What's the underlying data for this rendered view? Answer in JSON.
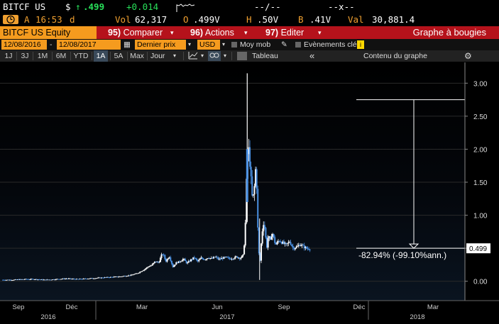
{
  "ticker": {
    "symbol": "BITCF US",
    "currency_symbol": "$",
    "arrow": "↑",
    "last_price": ".499",
    "change": "+0.014",
    "sparkline_label": "Γ",
    "range_text": "--/--",
    "range_text2": "--x--",
    "clock_icon": "clock-icon",
    "status_letter": "A",
    "time": "16:53",
    "time_suffix": "d",
    "vol_label": "Vol",
    "volume": "62,317",
    "open_label": "O",
    "open": ".499V",
    "high_label": "H",
    "high": ".50V",
    "bid_label": "B",
    "bid": ".41V",
    "val_label": "Val",
    "value": "30,881.4"
  },
  "menubar": {
    "equity": "BITCF US Equity",
    "items": [
      {
        "num": "95)",
        "label": "Comparer"
      },
      {
        "num": "96)",
        "label": "Actions"
      },
      {
        "num": "97)",
        "label": "Editer"
      }
    ],
    "chart_type": "Graphe à bougies"
  },
  "daterow": {
    "start_date": "12/08/2016",
    "dash": "-",
    "end_date": "12/08/2017",
    "price_field": "Dernier prix",
    "currency": "USD",
    "moy_mob": "Moy mob",
    "events": "Evènements clés",
    "info": "i"
  },
  "periodrow": {
    "periods": [
      "1J",
      "3J",
      "1M",
      "6M",
      "YTD",
      "1A",
      "5A",
      "Max"
    ],
    "active": "1A",
    "frequency": "Jour",
    "tableau": "Tableau",
    "collapse": "«",
    "content": "Contenu du graphe",
    "settings_icon": "gear-icon"
  },
  "chart_data": {
    "type": "candlestick",
    "ylim": [
      -0.1,
      3.1
    ],
    "yticks": [
      "3.00",
      "2.50",
      "2.00",
      "1.50",
      "1.00",
      "0.50",
      "0.00"
    ],
    "ytick_values": [
      3.0,
      2.5,
      2.0,
      1.5,
      1.0,
      0.5,
      0.0
    ],
    "last_price_label": "0.499",
    "last_price": 0.499,
    "month_labels": [
      "Sep",
      "Déc",
      "Mar",
      "Jun",
      "Sep",
      "Déc",
      "Mar"
    ],
    "year_labels": [
      "2016",
      "2017",
      "2018"
    ],
    "annotation": "-82.94% (-99.10%ann.)",
    "annotation_high": 2.75,
    "annotation_low": 0.5,
    "colors": {
      "up": "#ffffff",
      "down": "#4a90e2",
      "background": "#000000",
      "grid": "#2a2a2a"
    },
    "series": [
      {
        "x": 0.0,
        "y": 0.02
      },
      {
        "x": 0.03,
        "y": 0.02
      },
      {
        "x": 0.06,
        "y": 0.03
      },
      {
        "x": 0.09,
        "y": 0.03
      },
      {
        "x": 0.12,
        "y": 0.02
      },
      {
        "x": 0.15,
        "y": 0.03
      },
      {
        "x": 0.18,
        "y": 0.04
      },
      {
        "x": 0.21,
        "y": 0.03
      },
      {
        "x": 0.24,
        "y": 0.04
      },
      {
        "x": 0.27,
        "y": 0.05
      },
      {
        "x": 0.3,
        "y": 0.06
      },
      {
        "x": 0.33,
        "y": 0.07
      },
      {
        "x": 0.36,
        "y": 0.09
      },
      {
        "x": 0.38,
        "y": 0.12
      },
      {
        "x": 0.4,
        "y": 0.18
      },
      {
        "x": 0.41,
        "y": 0.22
      },
      {
        "x": 0.42,
        "y": 0.24
      },
      {
        "x": 0.43,
        "y": 0.3
      },
      {
        "x": 0.44,
        "y": 0.28
      },
      {
        "x": 0.45,
        "y": 0.42
      },
      {
        "x": 0.455,
        "y": 0.38
      },
      {
        "x": 0.46,
        "y": 0.3
      },
      {
        "x": 0.47,
        "y": 0.38
      },
      {
        "x": 0.48,
        "y": 0.22
      },
      {
        "x": 0.49,
        "y": 0.28
      },
      {
        "x": 0.5,
        "y": 0.3
      },
      {
        "x": 0.51,
        "y": 0.34
      },
      {
        "x": 0.52,
        "y": 0.27
      },
      {
        "x": 0.53,
        "y": 0.32
      },
      {
        "x": 0.54,
        "y": 0.36
      },
      {
        "x": 0.55,
        "y": 0.3
      },
      {
        "x": 0.56,
        "y": 0.35
      },
      {
        "x": 0.57,
        "y": 0.33
      },
      {
        "x": 0.58,
        "y": 0.36
      },
      {
        "x": 0.59,
        "y": 0.34
      },
      {
        "x": 0.6,
        "y": 0.37
      },
      {
        "x": 0.61,
        "y": 0.33
      },
      {
        "x": 0.62,
        "y": 0.35
      },
      {
        "x": 0.63,
        "y": 0.36
      },
      {
        "x": 0.64,
        "y": 0.34
      },
      {
        "x": 0.65,
        "y": 0.35
      },
      {
        "x": 0.66,
        "y": 0.37
      },
      {
        "x": 0.67,
        "y": 0.35
      },
      {
        "x": 0.68,
        "y": 0.4
      },
      {
        "x": 0.685,
        "y": 0.9
      },
      {
        "x": 0.69,
        "y": 1.9
      },
      {
        "x": 0.695,
        "y": 2.0
      },
      {
        "x": 0.7,
        "y": 1.6
      },
      {
        "x": 0.705,
        "y": 1.2
      },
      {
        "x": 0.71,
        "y": 1.4
      },
      {
        "x": 0.715,
        "y": 1.8
      },
      {
        "x": 0.72,
        "y": 0.8
      },
      {
        "x": 0.725,
        "y": 0.2
      },
      {
        "x": 0.73,
        "y": 0.6
      },
      {
        "x": 0.735,
        "y": 0.9
      },
      {
        "x": 0.74,
        "y": 0.8
      },
      {
        "x": 0.745,
        "y": 0.5
      },
      {
        "x": 0.75,
        "y": 0.7
      },
      {
        "x": 0.755,
        "y": 0.6
      },
      {
        "x": 0.76,
        "y": 0.75
      },
      {
        "x": 0.77,
        "y": 0.55
      },
      {
        "x": 0.78,
        "y": 0.62
      },
      {
        "x": 0.79,
        "y": 0.58
      },
      {
        "x": 0.8,
        "y": 0.55
      },
      {
        "x": 0.81,
        "y": 0.6
      },
      {
        "x": 0.82,
        "y": 0.5
      },
      {
        "x": 0.83,
        "y": 0.52
      },
      {
        "x": 0.84,
        "y": 0.56
      },
      {
        "x": 0.85,
        "y": 0.52
      },
      {
        "x": 0.86,
        "y": 0.49
      },
      {
        "x": 0.87,
        "y": 0.5
      }
    ],
    "spike_high": 3.15,
    "spike_low": 0.02
  }
}
